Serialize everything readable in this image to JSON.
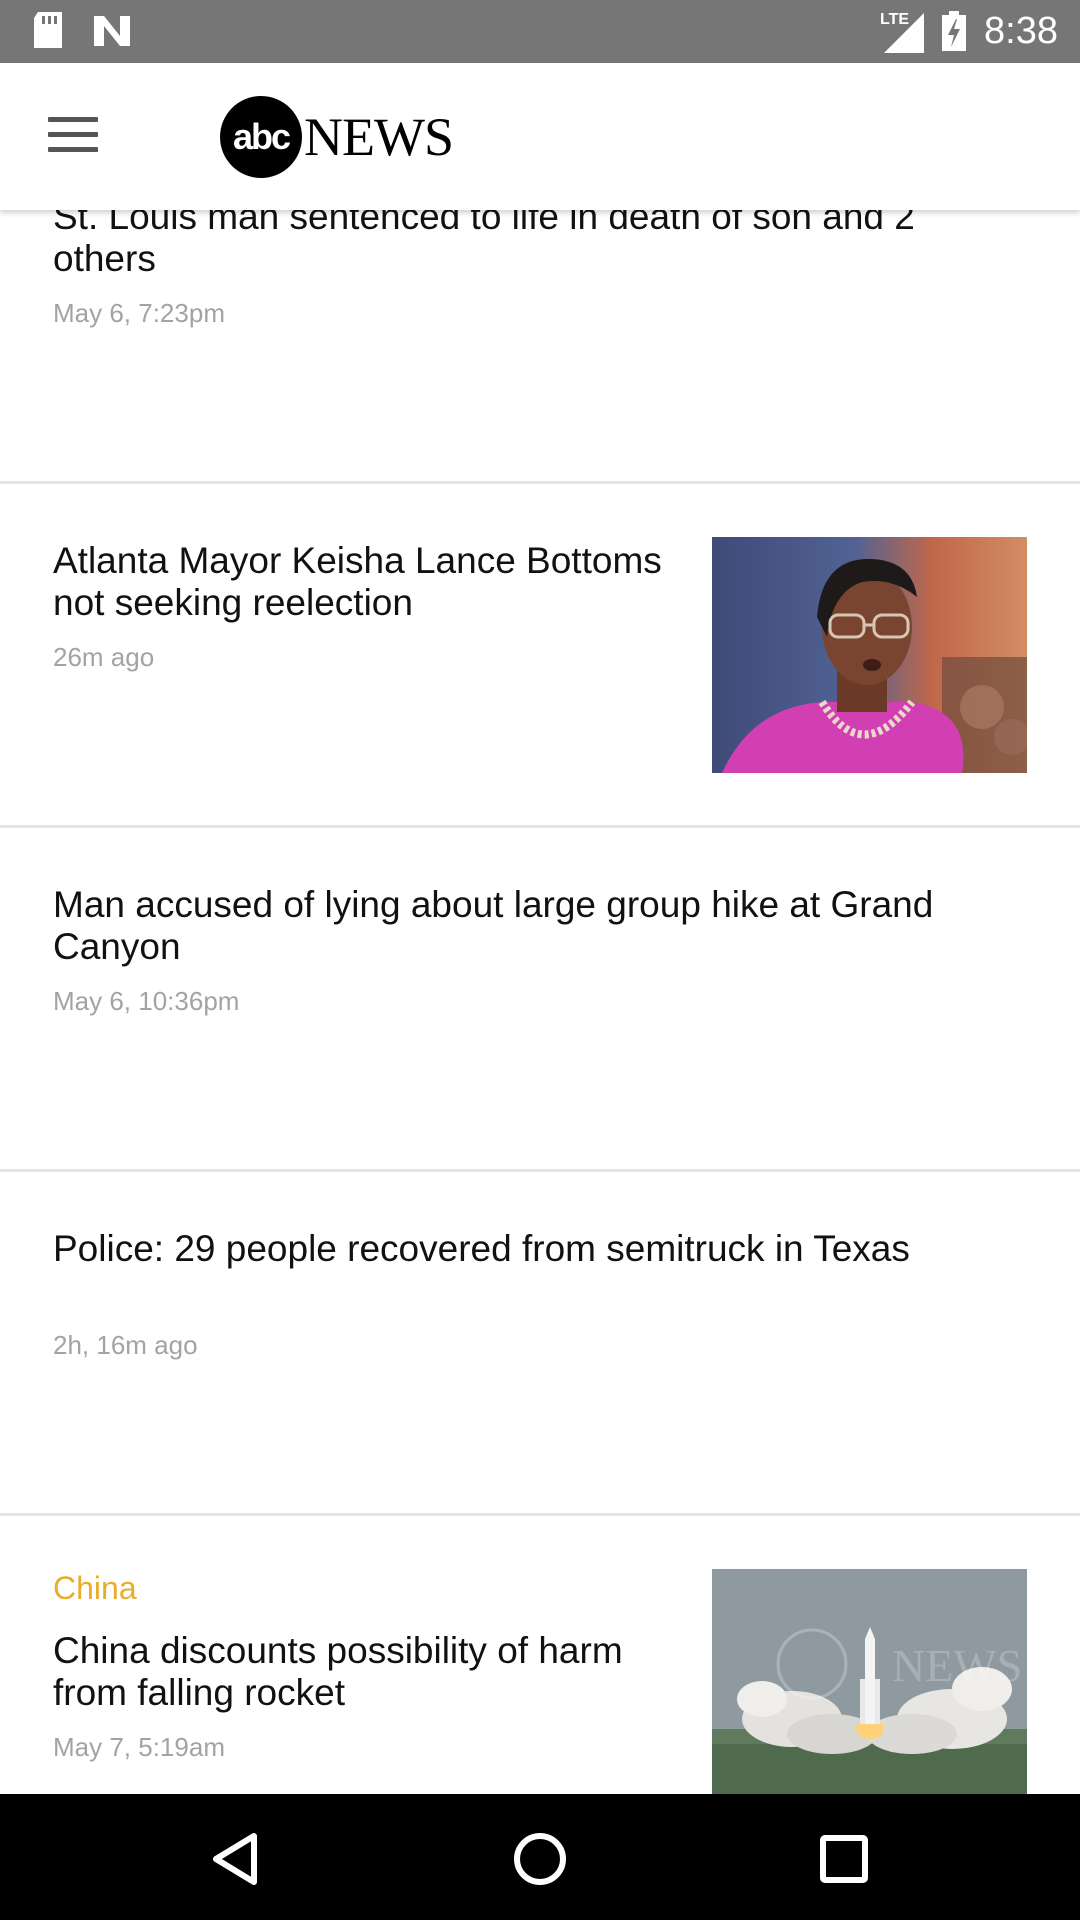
{
  "status_bar": {
    "time": "8:38",
    "network": "LTE",
    "icons": [
      "sd-card-icon",
      "n-notification-icon",
      "lte-signal-icon",
      "battery-charging-icon"
    ]
  },
  "app_bar": {
    "logo_abc": "abc",
    "logo_news": "NEWS"
  },
  "articles": [
    {
      "headline": "St. Louis man sentenced to life in death of son and 2 others",
      "time": "May 6, 7:23pm"
    },
    {
      "headline": "Atlanta Mayor Keisha Lance Bottoms not seeking reelection",
      "time": "26m ago",
      "image": "keisha-lance-bottoms-photo"
    },
    {
      "headline": "Man accused of lying about large group hike at Grand Canyon",
      "time": "May 6, 10:36pm"
    },
    {
      "headline": "Police: 29 people recovered from semitruck in Texas",
      "time": "2h, 16m ago"
    },
    {
      "tag": "China",
      "headline": "China discounts possibility of harm from falling rocket",
      "time": "May 7, 5:19am",
      "image": "rocket-launch-photo",
      "image_watermark": "abc NEWS"
    }
  ],
  "colors": {
    "status_bar": "#767676",
    "tag": "#e8ae2b",
    "time_text": "#a3a3a3",
    "divider": "#e6e6e6",
    "nav_bar": "#000000"
  }
}
